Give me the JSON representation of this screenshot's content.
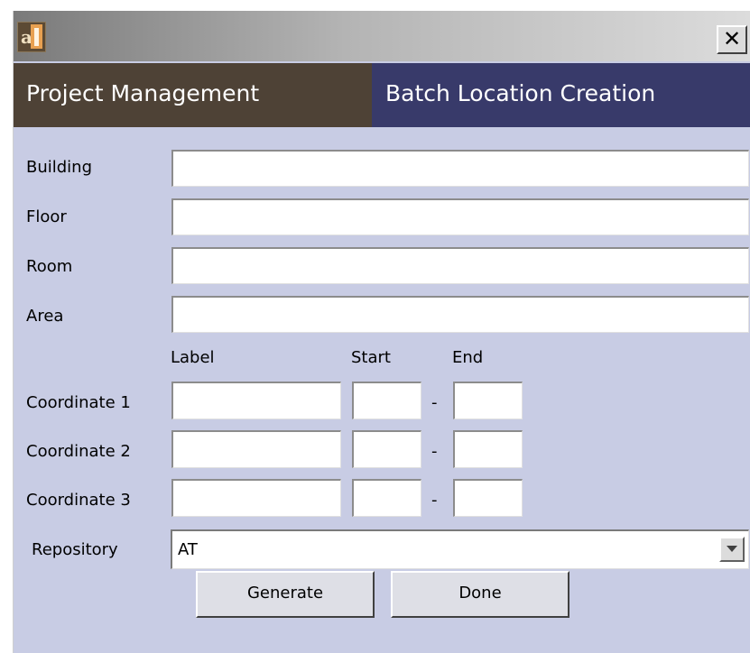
{
  "window": {
    "close_glyph": "✕"
  },
  "header": {
    "left_title": "Project Management",
    "right_title": "Batch Location Creation"
  },
  "form": {
    "fields": [
      {
        "label": "Building",
        "value": ""
      },
      {
        "label": "Floor",
        "value": ""
      },
      {
        "label": "Room",
        "value": ""
      },
      {
        "label": "Area",
        "value": ""
      }
    ],
    "coord_headers": {
      "label": "Label",
      "start": "Start",
      "end": "End"
    },
    "coordinates": [
      {
        "label": "Coordinate 1",
        "name": "",
        "start": "",
        "end": ""
      },
      {
        "label": "Coordinate 2",
        "name": "",
        "start": "",
        "end": ""
      },
      {
        "label": "Coordinate 3",
        "name": "",
        "start": "",
        "end": ""
      }
    ],
    "range_separator": "-",
    "repository": {
      "label": "Repository",
      "selected": "AT"
    }
  },
  "buttons": {
    "generate": "Generate",
    "done": "Done"
  },
  "colors": {
    "background": "#c8cce4",
    "header_left": "#4e4236",
    "header_right": "#383a6a"
  },
  "icons": {
    "app": "app-logo-icon",
    "close": "close-icon",
    "dropdown": "chevron-down-icon"
  }
}
